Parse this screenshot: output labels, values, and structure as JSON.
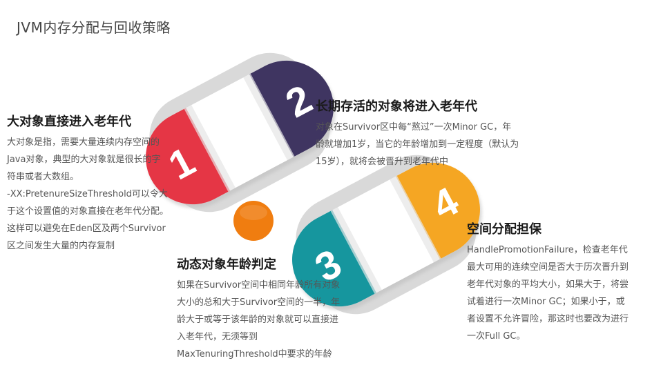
{
  "title": "JVM内存分配与回收策略",
  "steps": [
    {
      "number": "1",
      "color": "#e53645",
      "heading": "大对象直接进入老年代",
      "lines": [
        "大对象是指，需要大量连续内存空间的",
        "Java对象，典型的大对象就是很长的字",
        "符串或者大数组。",
        "-XX:PretenureSizeThreshold可以令大",
        "于这个设置值的对象直接在老年代分配。",
        "这样可以避免在Eden区及两个Survivor",
        "区之间发生大量的内存复制"
      ]
    },
    {
      "number": "2",
      "color": "#3f3561",
      "heading": "长期存活的对象将进入老年代",
      "lines": [
        "对象在Survivor区中每“熬过”一次Minor GC，年",
        "龄就增加1岁，当它的年龄增加到一定程度（默认为",
        "15岁），就将会被晋升到老年代中"
      ]
    },
    {
      "number": "3",
      "color": "#16969e",
      "heading": "动态对象年龄判定",
      "lines": [
        "如果在Survivor空间中相同年龄所有对象",
        "大小的总和大于Survivor空间的一半，年",
        "龄大于或等于该年龄的对象就可以直接进",
        "入老年代，无须等到",
        "MaxTenuringThreshold中要求的年龄"
      ]
    },
    {
      "number": "4",
      "color": "#f5a623",
      "heading": "空间分配担保",
      "lines": [
        "HandlePromotionFailure，检查老年代",
        "最大可用的连续空间是否大于历次晋升到",
        "老年代对象的平均大小，如果大于，将尝",
        "试着进行一次Minor GC；如果小于，或",
        "者设置不允许冒险，那这时也要改为进行",
        "一次Full GC。"
      ]
    }
  ],
  "center_dot_color": "#f07d10"
}
